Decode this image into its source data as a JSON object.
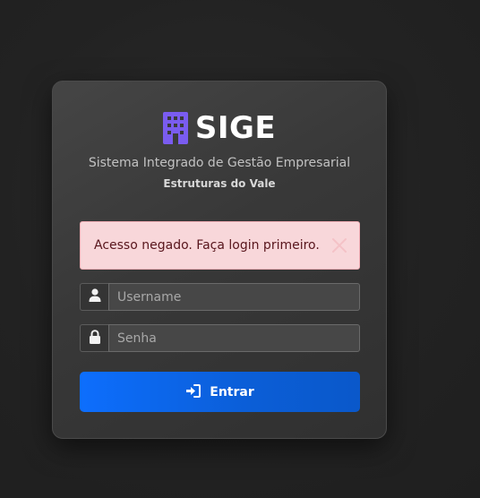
{
  "brand": {
    "title": "SIGE",
    "icon": "building-icon",
    "icon_color": "#7a5cf0"
  },
  "subtitle": "Sistema Integrado de Gestão Empresarial",
  "company": "Estruturas do Vale",
  "alert": {
    "message": "Acesso negado. Faça login primeiro.",
    "close_icon": "close-icon",
    "background": "#f8d7da"
  },
  "form": {
    "username": {
      "placeholder": "Username",
      "value": "",
      "icon": "user-icon"
    },
    "password": {
      "placeholder": "Senha",
      "value": "",
      "icon": "lock-icon"
    },
    "submit": {
      "label": "Entrar",
      "icon": "sign-in-icon",
      "color": "#0d6efd"
    }
  }
}
